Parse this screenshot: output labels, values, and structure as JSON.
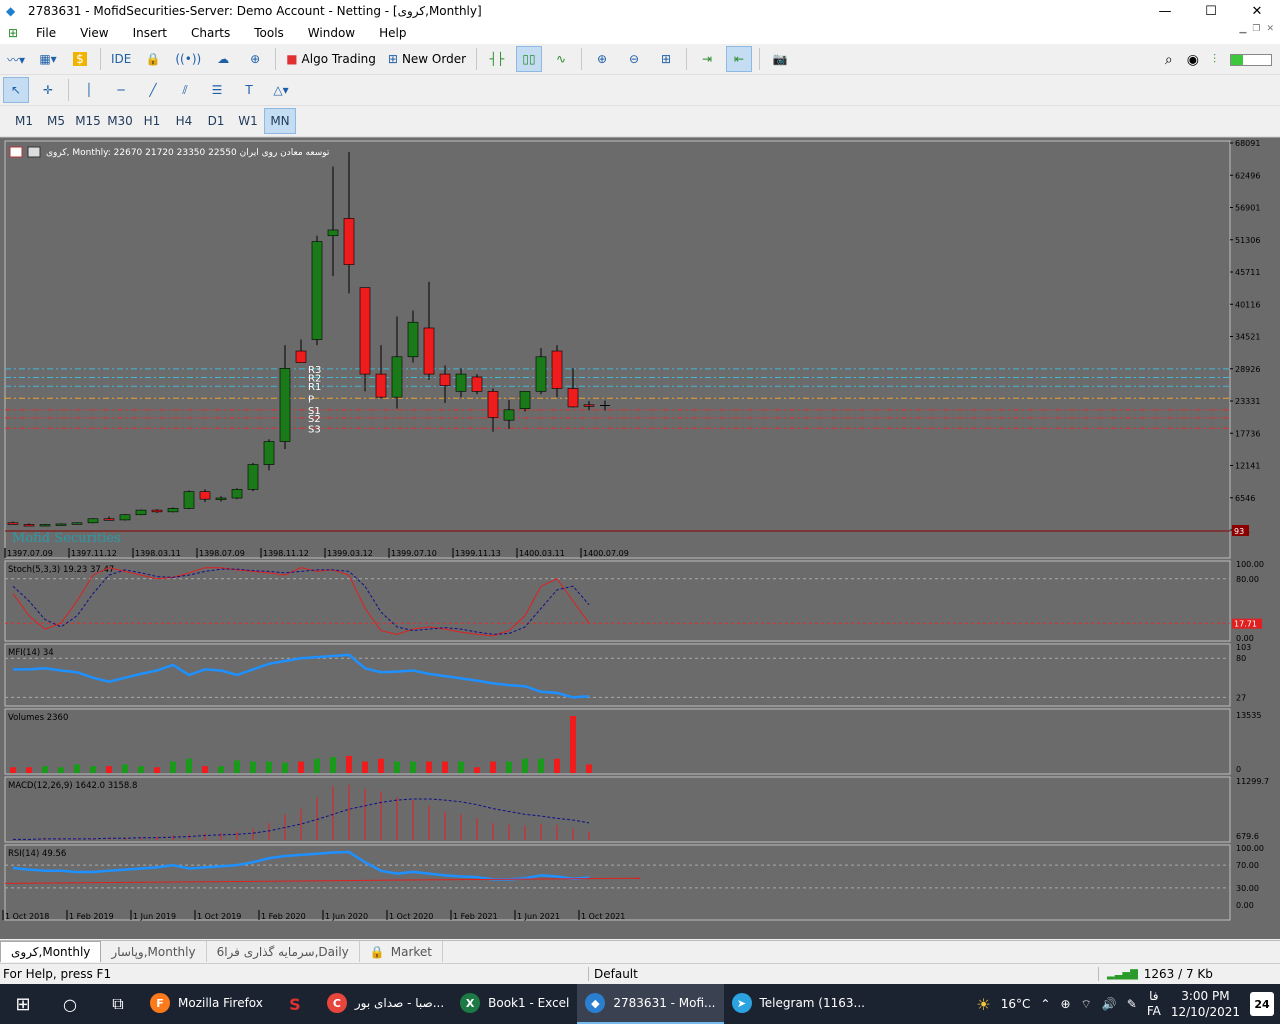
{
  "window": {
    "title": "2783631 - MofidSecurities-Server: Demo Account - Netting - [کروی,Monthly]",
    "controls": [
      "—",
      "☐",
      "✕"
    ]
  },
  "menu": {
    "items": [
      "File",
      "View",
      "Insert",
      "Charts",
      "Tools",
      "Window",
      "Help"
    ]
  },
  "toolbar": {
    "ide_label": "IDE",
    "algo_label": "Algo Trading",
    "new_order_label": "New Order"
  },
  "timeframes": {
    "items": [
      "M1",
      "M5",
      "M15",
      "M30",
      "H1",
      "H4",
      "D1",
      "W1",
      "MN"
    ],
    "active": "MN"
  },
  "chart": {
    "header": "کروی, Monthly:  22670 21720 23350 22550   توسعه معادن روی ایران",
    "watermark": "Mofid Securities",
    "price_scale": [
      "68091",
      "62496",
      "56901",
      "51306",
      "45711",
      "40116",
      "34521",
      "28926",
      "23331",
      "17736",
      "12141",
      "6546",
      "951"
    ],
    "price_marker": "93",
    "pivot_labels": [
      "R3",
      "R2",
      "R1",
      "P",
      "S1",
      "S2",
      "S3"
    ],
    "main_dates": [
      "1397.07.09",
      "1397.11.12",
      "1398.03.11",
      "1398.07.09",
      "1398.11.12",
      "1399.03.12",
      "1399.07.10",
      "1399.11.13",
      "1400.03.11",
      "1400.07.09"
    ],
    "bottom_dates": [
      "1 Oct 2018",
      "1 Feb 2019",
      "1 Jun 2019",
      "1 Oct 2019",
      "1 Feb 2020",
      "1 Jun 2020",
      "1 Oct 2020",
      "1 Feb 2021",
      "1 Jun 2021",
      "1 Oct 2021"
    ]
  },
  "indicators": {
    "stoch": {
      "label": "Stoch(5,3,3) 19.23 37.47",
      "scale": [
        "100.00",
        "80.00",
        "0.00"
      ],
      "marker": "17.71"
    },
    "mfi": {
      "label": "MFI(14) 34",
      "scale": [
        "103",
        "80",
        "27"
      ]
    },
    "volumes": {
      "label": "Volumes 2360",
      "scale": [
        "13535",
        "0"
      ]
    },
    "macd": {
      "label": "MACD(12,26,9) 1642.0 3158.8",
      "scale": [
        "11299.7",
        "679.6"
      ]
    },
    "rsi": {
      "label": "RSI(14) 49.56",
      "scale": [
        "100.00",
        "70.00",
        "30.00",
        "0.00"
      ]
    }
  },
  "chart_data": {
    "type": "candlestick",
    "title": "کروی, Monthly",
    "candles": [
      {
        "o": 2200,
        "h": 2400,
        "l": 1900,
        "c": 2000
      },
      {
        "o": 1900,
        "h": 2100,
        "l": 1700,
        "c": 1800
      },
      {
        "o": 1800,
        "h": 2000,
        "l": 1700,
        "c": 1900
      },
      {
        "o": 1900,
        "h": 2100,
        "l": 1800,
        "c": 2000
      },
      {
        "o": 2000,
        "h": 2300,
        "l": 1900,
        "c": 2200
      },
      {
        "o": 2200,
        "h": 3000,
        "l": 2100,
        "c": 2900
      },
      {
        "o": 2900,
        "h": 3300,
        "l": 2600,
        "c": 2700
      },
      {
        "o": 2700,
        "h": 3700,
        "l": 2600,
        "c": 3600
      },
      {
        "o": 3600,
        "h": 4500,
        "l": 3500,
        "c": 4400
      },
      {
        "o": 4400,
        "h": 4600,
        "l": 3900,
        "c": 4100
      },
      {
        "o": 4100,
        "h": 4900,
        "l": 4000,
        "c": 4700
      },
      {
        "o": 4700,
        "h": 7800,
        "l": 4600,
        "c": 7600
      },
      {
        "o": 7600,
        "h": 8000,
        "l": 5800,
        "c": 6300
      },
      {
        "o": 6300,
        "h": 6800,
        "l": 5900,
        "c": 6500
      },
      {
        "o": 6500,
        "h": 8200,
        "l": 6300,
        "c": 8000
      },
      {
        "o": 8000,
        "h": 12600,
        "l": 7700,
        "c": 12300
      },
      {
        "o": 12300,
        "h": 16700,
        "l": 11300,
        "c": 16300
      },
      {
        "o": 16300,
        "h": 33000,
        "l": 15000,
        "c": 29000
      },
      {
        "o": 32000,
        "h": 34000,
        "l": 30000,
        "c": 30000
      },
      {
        "o": 34000,
        "h": 52000,
        "l": 33000,
        "c": 51000
      },
      {
        "o": 52000,
        "h": 64000,
        "l": 45000,
        "c": 53000
      },
      {
        "o": 55000,
        "h": 66500,
        "l": 42000,
        "c": 47000
      },
      {
        "o": 43000,
        "h": 43000,
        "l": 25000,
        "c": 28000
      },
      {
        "o": 28000,
        "h": 33000,
        "l": 23800,
        "c": 24000
      },
      {
        "o": 24000,
        "h": 38000,
        "l": 22000,
        "c": 31000
      },
      {
        "o": 31000,
        "h": 39000,
        "l": 30000,
        "c": 37000
      },
      {
        "o": 36000,
        "h": 44000,
        "l": 27000,
        "c": 28000
      },
      {
        "o": 28000,
        "h": 29500,
        "l": 23000,
        "c": 26000
      },
      {
        "o": 25000,
        "h": 29000,
        "l": 24000,
        "c": 28000
      },
      {
        "o": 27500,
        "h": 28000,
        "l": 24500,
        "c": 25000
      },
      {
        "o": 25000,
        "h": 25500,
        "l": 18000,
        "c": 20500
      },
      {
        "o": 20000,
        "h": 23500,
        "l": 18500,
        "c": 21800
      },
      {
        "o": 22000,
        "h": 25000,
        "l": 21500,
        "c": 25000
      },
      {
        "o": 25000,
        "h": 32500,
        "l": 24500,
        "c": 31000
      },
      {
        "o": 32000,
        "h": 33000,
        "l": 24000,
        "c": 25500
      },
      {
        "o": 25500,
        "h": 29000,
        "l": 22200,
        "c": 22300
      },
      {
        "o": 22670,
        "h": 23350,
        "l": 21720,
        "c": 22550
      }
    ],
    "ylim": [
      951,
      68091
    ],
    "pivots": {
      "R3": 28900,
      "R2": 27400,
      "R1": 25900,
      "P": 23800,
      "S1": 21800,
      "S2": 20400,
      "S3": 18600
    }
  },
  "tabs": {
    "items": [
      "کروی,Monthly",
      "وپاسار,Monthly",
      "سرمایه گذاری فرا6,Daily",
      "Market"
    ],
    "active": 0
  },
  "status": {
    "help": "For Help, press F1",
    "profile": "Default",
    "traffic": "1263 / 7 Kb"
  },
  "taskbar": {
    "apps": [
      {
        "label": "Mozilla Firefox",
        "color": "#ff7a1a",
        "glyph": "F"
      },
      {
        "label": "صبا - صدای بور...",
        "color": "#e8453c",
        "glyph": "C"
      },
      {
        "label": "Book1 - Excel",
        "color": "#1d7a45",
        "glyph": "X"
      },
      {
        "label": "2783631 - Mofi...",
        "color": "#2a7fd0",
        "glyph": "◆"
      },
      {
        "label": "Telegram (1163...",
        "color": "#2aa3e0",
        "glyph": "➤"
      }
    ],
    "temp": "16°C",
    "lang1": "فا",
    "lang2": "FA",
    "time": "3:00 PM",
    "date": "12/10/2021",
    "notif_count": "24"
  }
}
